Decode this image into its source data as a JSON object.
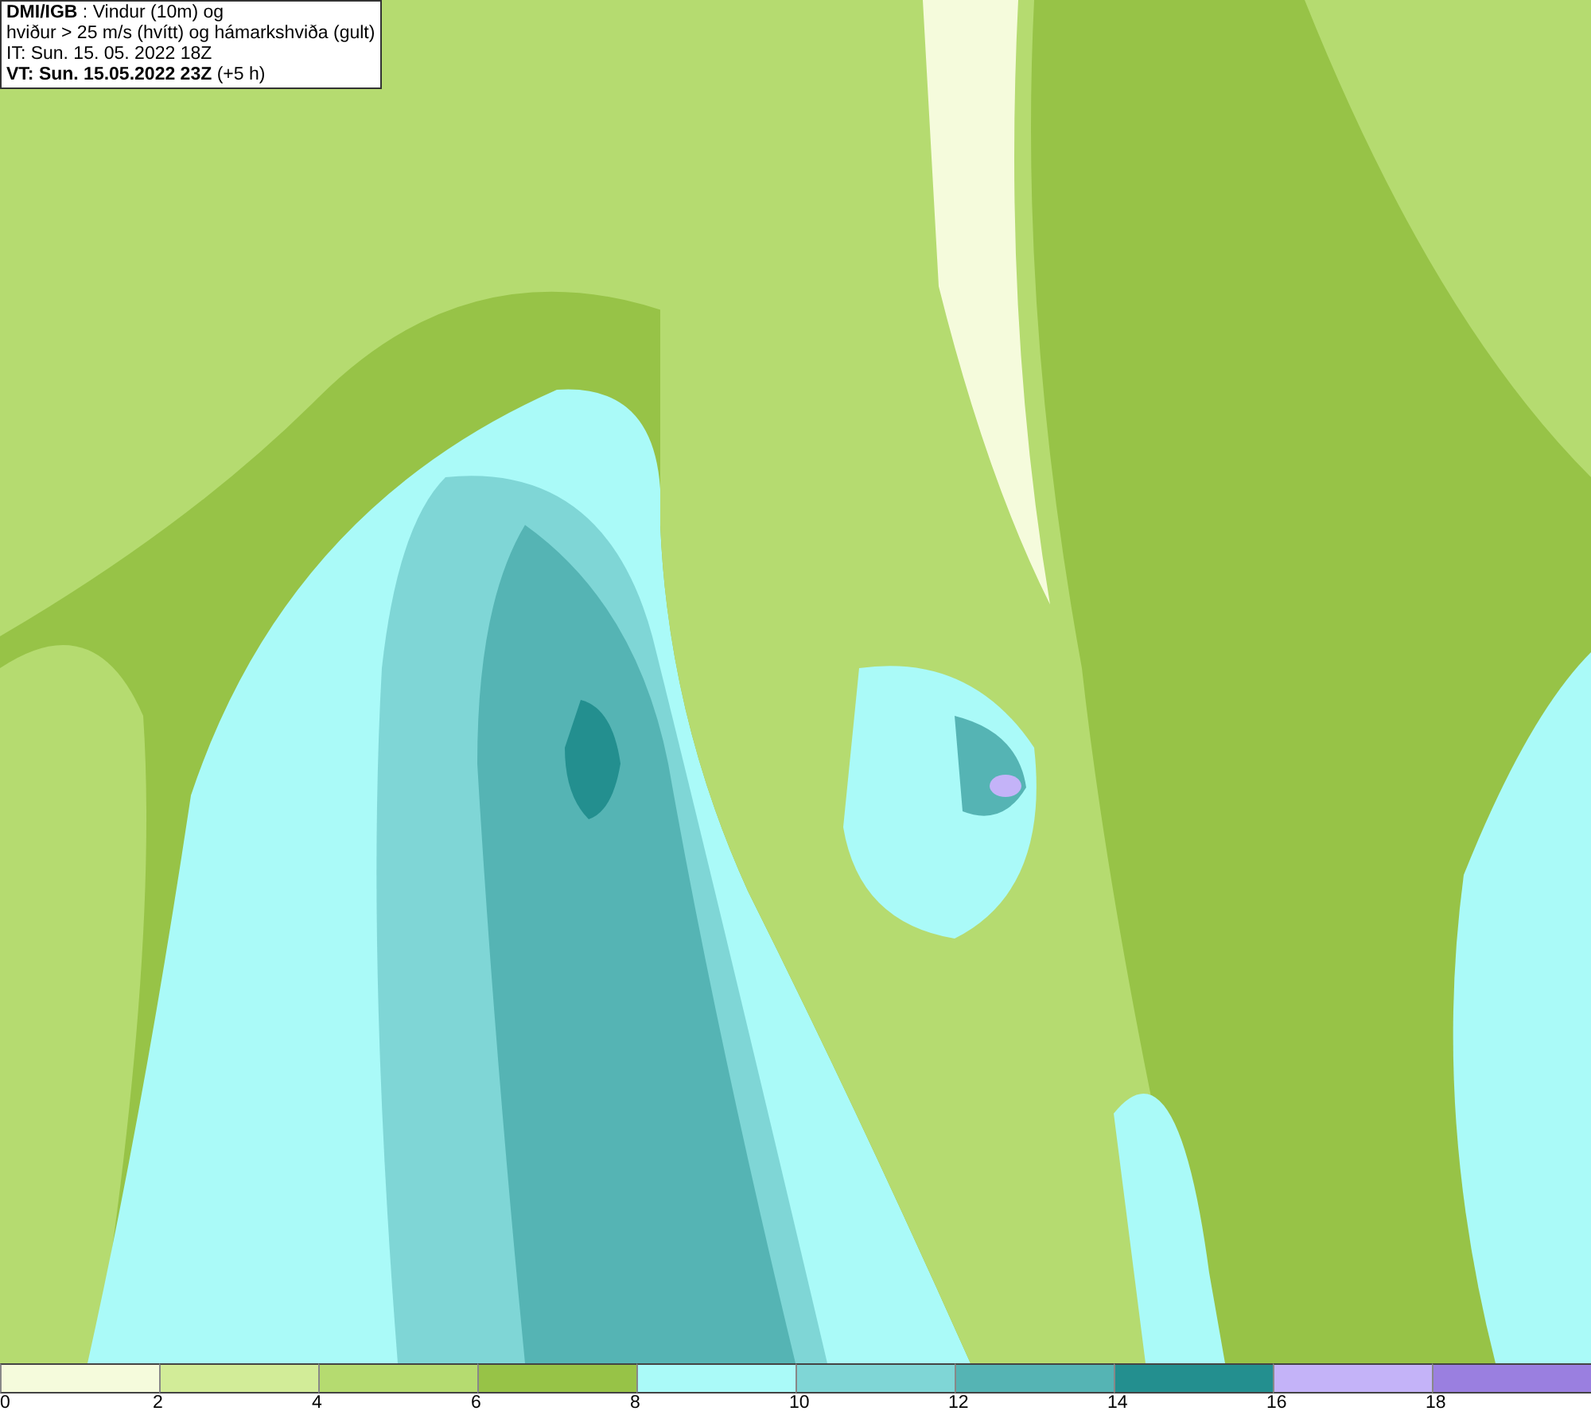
{
  "header": {
    "line_1": "**DMI/IGB** : Vindur (10m) og",
    "line_2": "hviður > 25 m/s (hvítt) og hámarkshviða (gult)",
    "line_3": "IT: Sun. 15. 05. 2022 18Z",
    "line_4": "**VT: Sun. 15.05.2022 23Z** (+5 h)"
  },
  "legend": {
    "segments": [
      {
        "color": "#f5fbdc",
        "label": "0"
      },
      {
        "color": "#d2ec98",
        "label": "2"
      },
      {
        "color": "#b5db70",
        "label": "4"
      },
      {
        "color": "#97c347",
        "label": "6"
      },
      {
        "color": "#aafaf8",
        "label": "8"
      },
      {
        "color": "#7fd6d6",
        "label": "10"
      },
      {
        "color": "#55b4b4",
        "label": "12"
      },
      {
        "color": "#238f8f",
        "label": "14"
      },
      {
        "color": "#c4b3f8",
        "label": "16"
      },
      {
        "color": "#9a7fe0",
        "label": "18"
      }
    ]
  }
}
